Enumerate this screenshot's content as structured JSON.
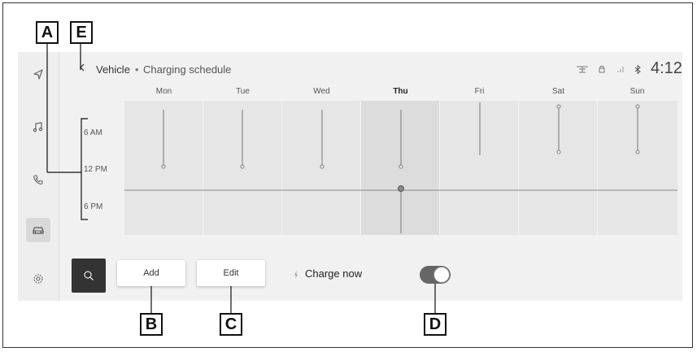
{
  "breadcrumb": {
    "back_icon": "chevron-left-icon",
    "parent": "Vehicle",
    "separator": "•",
    "current": "Charging schedule"
  },
  "status_bar": {
    "icons": [
      "network-icon",
      "lock-icon",
      "signal-icon",
      "bluetooth-icon"
    ],
    "time": "4:12"
  },
  "sidebar": {
    "items": [
      {
        "name": "navigation-icon"
      },
      {
        "name": "music-icon"
      },
      {
        "name": "phone-icon"
      },
      {
        "name": "car-icon",
        "active": true
      },
      {
        "name": "settings-icon"
      }
    ]
  },
  "schedule": {
    "days": [
      "Mon",
      "Tue",
      "Wed",
      "Thu",
      "Fri",
      "Sat",
      "Sun"
    ],
    "today": "Thu",
    "time_labels": [
      "6 AM",
      "12 PM",
      "6 PM"
    ]
  },
  "actions": {
    "search_icon": "search-icon",
    "add_label": "Add",
    "edit_label": "Edit",
    "charge_icon": "lightning-icon",
    "charge_now_label": "Charge now",
    "charge_now_on": true
  },
  "callouts": {
    "a": "A",
    "b": "B",
    "c": "C",
    "d": "D",
    "e": "E"
  },
  "colors": {
    "screen_bg": "#f1f1f1",
    "today_column": "#dcdcdc",
    "toggle_on": "#666666"
  }
}
